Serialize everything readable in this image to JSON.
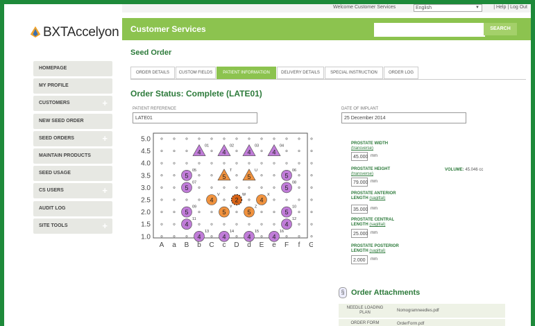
{
  "brand": {
    "logo_text": "BXTAccelyon"
  },
  "topbar": {
    "welcome": "Welcome Customer Services",
    "language": "English",
    "links": "| Help | Log Out"
  },
  "header": {
    "title": "Customer Services",
    "search_button": "SEARCH",
    "search_value": ""
  },
  "sidebar": {
    "items": [
      {
        "label": "HOMEPAGE",
        "expand": ""
      },
      {
        "label": "MY PROFILE",
        "expand": ""
      },
      {
        "label": "CUSTOMERS",
        "expand": "+"
      },
      {
        "label": "NEW SEED ORDER",
        "expand": ""
      },
      {
        "label": "SEED ORDERS",
        "expand": "+"
      },
      {
        "label": "MAINTAIN PRODUCTS",
        "expand": ""
      },
      {
        "label": "SEED USAGE",
        "expand": ""
      },
      {
        "label": "CS USERS",
        "expand": "+"
      },
      {
        "label": "AUDIT LOG",
        "expand": ""
      },
      {
        "label": "SITE TOOLS",
        "expand": "+"
      }
    ]
  },
  "page": {
    "section_title": "Seed Order",
    "status": "Order Status: Complete (LATE01)"
  },
  "tabs": [
    "ORDER DETAILS",
    "CUSTOM FIELDS",
    "PATIENT INFORMATION",
    "DELIVERY DETAILS",
    "SPECIAL INSTRUCTION",
    "ORDER LOG"
  ],
  "active_tab": 2,
  "fields": {
    "patient_reference_label": "PATIENT REFERENCE",
    "patient_reference": "LATE01",
    "date_of_implant_label": "DATE OF IMPLANT",
    "date_of_implant": "25 December 2014"
  },
  "template_grid": {
    "y_labels": [
      "5.0",
      "4.5",
      "4.0",
      "3.5",
      "3.0",
      "2.5",
      "2.0",
      "1.5",
      "1.0"
    ],
    "x_labels": [
      "A",
      "a",
      "B",
      "b",
      "C",
      "c",
      "D",
      "d",
      "E",
      "e",
      "F",
      "f",
      "G"
    ],
    "colors": {
      "purple": "#c07cd8",
      "orange": "#f0923e",
      "highlight": "#d86418"
    },
    "markers": [
      {
        "shape": "triangle",
        "color": "purple",
        "col": 3,
        "row": 4.5,
        "text": "4",
        "tag": "01"
      },
      {
        "shape": "triangle",
        "color": "purple",
        "col": 5,
        "row": 4.5,
        "text": "4",
        "tag": "02"
      },
      {
        "shape": "triangle",
        "color": "purple",
        "col": 7,
        "row": 4.5,
        "text": "4",
        "tag": "03"
      },
      {
        "shape": "triangle",
        "color": "purple",
        "col": 9,
        "row": 4.5,
        "text": "4",
        "tag": "04"
      },
      {
        "shape": "circle",
        "color": "purple",
        "col": 2,
        "row": 3.5,
        "text": "5",
        "tag": "05"
      },
      {
        "shape": "circle",
        "color": "purple",
        "col": 10,
        "row": 3.5,
        "text": "5",
        "tag": "06"
      },
      {
        "shape": "circle",
        "color": "purple",
        "col": 2,
        "row": 3.0,
        "text": "5",
        "tag": "07"
      },
      {
        "shape": "circle",
        "color": "purple",
        "col": 10,
        "row": 3.0,
        "text": "5",
        "tag": "08"
      },
      {
        "shape": "triangle",
        "color": "orange",
        "col": 5,
        "row": 3.5,
        "text": "5",
        "tag": "T"
      },
      {
        "shape": "triangle",
        "color": "orange",
        "col": 7,
        "row": 3.5,
        "text": "5",
        "tag": "U"
      },
      {
        "shape": "circle",
        "color": "orange",
        "col": 4,
        "row": 2.5,
        "text": "4",
        "tag": "V"
      },
      {
        "shape": "circle-dashed",
        "color": "orange",
        "col": 6,
        "row": 2.5,
        "text": "2",
        "tag": "W"
      },
      {
        "shape": "circle",
        "color": "orange",
        "col": 8,
        "row": 2.5,
        "text": "4",
        "tag": "X"
      },
      {
        "shape": "circle",
        "color": "purple",
        "col": 2,
        "row": 2.0,
        "text": "5",
        "tag": "09"
      },
      {
        "shape": "circle",
        "color": "orange",
        "col": 5,
        "row": 2.0,
        "text": "5",
        "tag": "Y"
      },
      {
        "shape": "circle",
        "color": "orange",
        "col": 7,
        "row": 2.0,
        "text": "5",
        "tag": "Z"
      },
      {
        "shape": "circle",
        "color": "purple",
        "col": 10,
        "row": 2.0,
        "text": "5",
        "tag": "10"
      },
      {
        "shape": "circle",
        "color": "purple",
        "col": 2,
        "row": 1.5,
        "text": "4",
        "tag": "11"
      },
      {
        "shape": "circle",
        "color": "purple",
        "col": 10,
        "row": 1.5,
        "text": "4",
        "tag": "12"
      },
      {
        "shape": "circle",
        "color": "purple",
        "col": 3,
        "row": 1.0,
        "text": "4",
        "tag": "13"
      },
      {
        "shape": "circle",
        "color": "purple",
        "col": 5,
        "row": 1.0,
        "text": "4",
        "tag": "14"
      },
      {
        "shape": "circle",
        "color": "purple",
        "col": 7,
        "row": 1.0,
        "text": "4",
        "tag": "15"
      },
      {
        "shape": "circle",
        "color": "purple",
        "col": 9,
        "row": 1.0,
        "text": "4",
        "tag": "16"
      }
    ]
  },
  "prostate": {
    "width_label": "PROSTATE WIDTH",
    "width_sub": "(transverse)",
    "width_value": "45.000",
    "height_label": "PROSTATE HEIGHT",
    "height_sub": "(transverse)",
    "height_value": "79.000",
    "anterior_label": "PROSTATE ANTERIOR",
    "anterior_label2": "LENGTH",
    "anterior_sub": "(sagittal)",
    "anterior_value": "35.000",
    "central_label": "PROSTATE CENTRAL",
    "central_label2": "LENGTH",
    "central_sub": "(sagittal)",
    "central_value": "25.000",
    "posterior_label": "PROSTATE POSTERIOR",
    "posterior_label2": "LENGTH",
    "posterior_sub": "(sagittal)",
    "posterior_value": "2.000",
    "unit": "mm",
    "volume_label": "VOLUME:",
    "volume_value": "45.046 cc"
  },
  "attachments": {
    "title": "Order Attachments",
    "rows": [
      {
        "key": "NEEDLE LOADING PLAN",
        "value": "Nomogramneedles.pdf"
      },
      {
        "key": "ORDER FORM",
        "value": "OrderForm.pdf"
      }
    ]
  }
}
